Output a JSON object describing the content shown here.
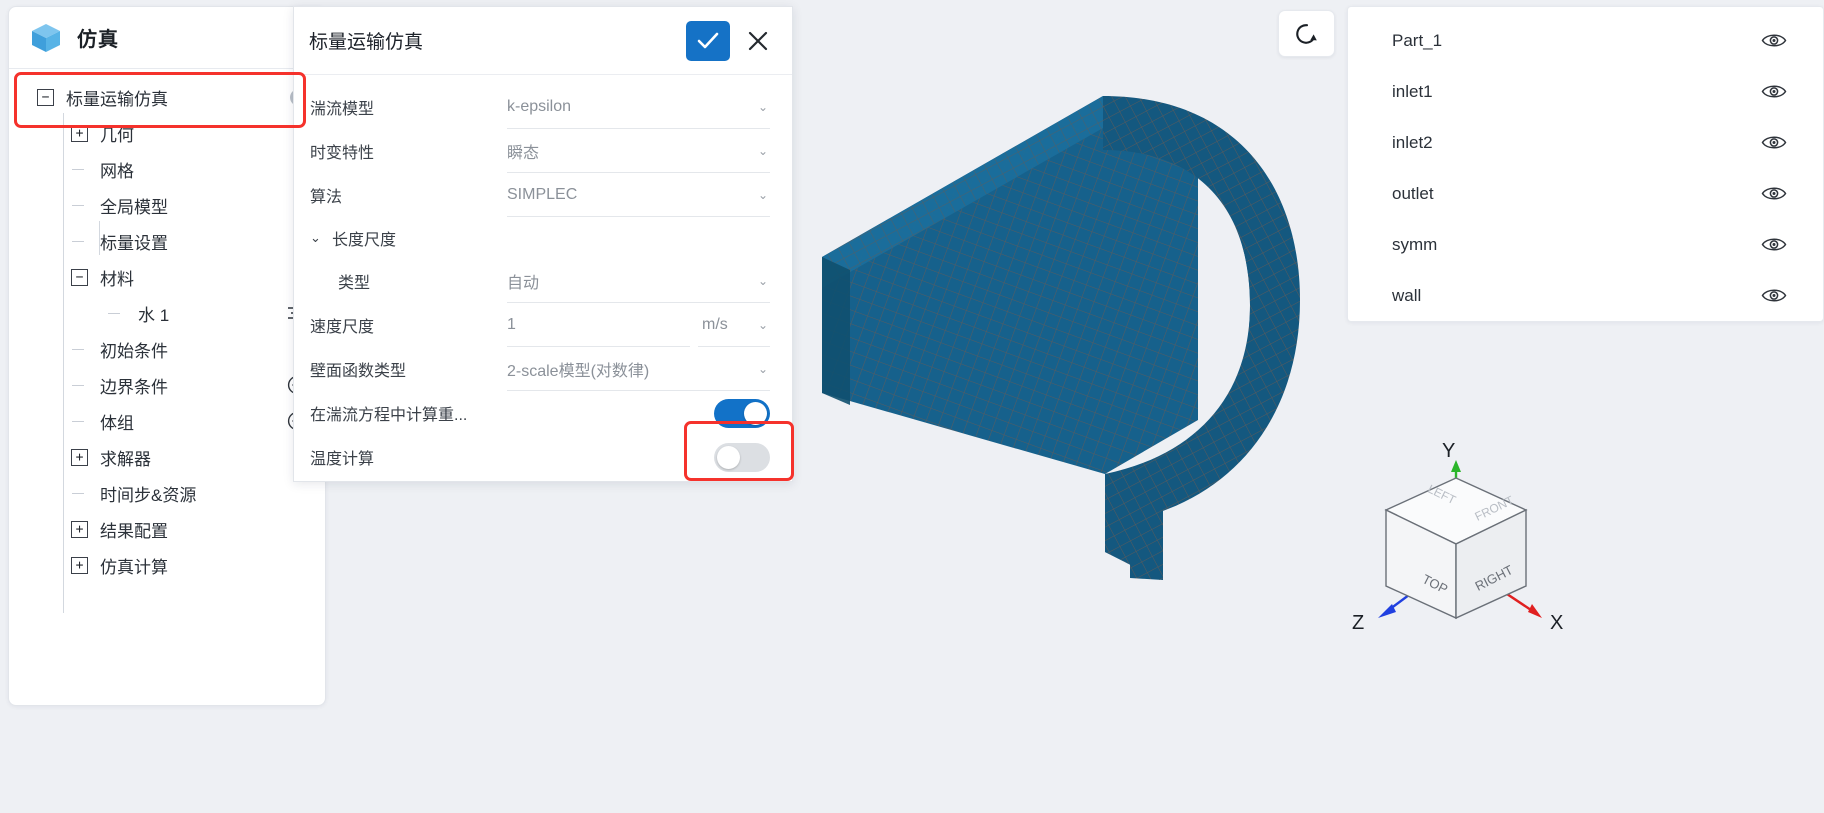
{
  "app": {
    "title": "仿真",
    "logo_icon": "cube-icon",
    "caret_icon": "chevron-down-icon"
  },
  "sidebar": {
    "tree": [
      {
        "label": "标量运输仿真",
        "expander": "−",
        "level": 0,
        "selected": true,
        "badge": "!"
      },
      {
        "label": "几何",
        "expander": "+",
        "level": 1,
        "selected": false
      },
      {
        "label": "网格",
        "expander": "",
        "level": 1,
        "selected": false
      },
      {
        "label": "全局模型",
        "expander": "",
        "level": 1,
        "selected": false
      },
      {
        "label": "标量设置",
        "expander": "",
        "level": 1,
        "selected": false
      },
      {
        "label": "材料",
        "expander": "−",
        "level": 1,
        "selected": false
      },
      {
        "label": "水 1",
        "expander": "",
        "level": 2,
        "selected": false,
        "action": "list-icon"
      },
      {
        "label": "初始条件",
        "expander": "",
        "level": 1,
        "selected": false
      },
      {
        "label": "边界条件",
        "expander": "",
        "level": 1,
        "selected": false,
        "action": "plus-circle-icon"
      },
      {
        "label": "体组",
        "expander": "",
        "level": 1,
        "selected": false,
        "action": "plus-circle-icon"
      },
      {
        "label": "求解器",
        "expander": "+",
        "level": 1,
        "selected": false
      },
      {
        "label": "时间步&资源",
        "expander": "",
        "level": 1,
        "selected": false
      },
      {
        "label": "结果配置",
        "expander": "+",
        "level": 1,
        "selected": false
      },
      {
        "label": "仿真计算",
        "expander": "+",
        "level": 1,
        "selected": false
      }
    ]
  },
  "dialog": {
    "title": "标量运输仿真",
    "confirm_icon": "check-icon",
    "cancel_icon": "close-icon",
    "fields": {
      "turbulence_model_label": "湍流模型",
      "turbulence_model_value": "k-epsilon",
      "time_behavior_label": "时变特性",
      "time_behavior_value": "瞬态",
      "algorithm_label": "算法",
      "algorithm_value": "SIMPLEC",
      "length_scale_group": "长度尺度",
      "type_label": "类型",
      "type_value": "自动",
      "velocity_scale_label": "速度尺度",
      "velocity_scale_value": "1",
      "velocity_scale_unit": "m/s",
      "wall_function_label": "壁面函数类型",
      "wall_function_value": "2-scale模型(对数律)",
      "gravity_toggle_label": "在湍流方程中计算重...",
      "gravity_toggle_state": "on",
      "temperature_toggle_label": "温度计算",
      "temperature_toggle_state": "off"
    }
  },
  "viewport": {
    "reset_icon": "reset-view-icon",
    "axis_cube": {
      "labels": {
        "y": "Y",
        "x": "X",
        "z": "Z"
      },
      "faces": {
        "top": "TOP",
        "right": "RIGHT",
        "left": "LEFT",
        "front": "FRONT"
      }
    }
  },
  "parts_panel": {
    "items": [
      {
        "label": "Part_1",
        "visibility_icon": "eye-icon"
      },
      {
        "label": "inlet1",
        "visibility_icon": "eye-icon"
      },
      {
        "label": "inlet2",
        "visibility_icon": "eye-icon"
      },
      {
        "label": "outlet",
        "visibility_icon": "eye-icon"
      },
      {
        "label": "symm",
        "visibility_icon": "eye-icon"
      },
      {
        "label": "wall",
        "visibility_icon": "eye-icon"
      }
    ]
  },
  "colors": {
    "accent": "#1572c6",
    "highlight": "#f5322c",
    "selection_bg": "#e8f1fb",
    "mesh_fill": "#16618c",
    "canvas_bg": "#eef0f4"
  }
}
